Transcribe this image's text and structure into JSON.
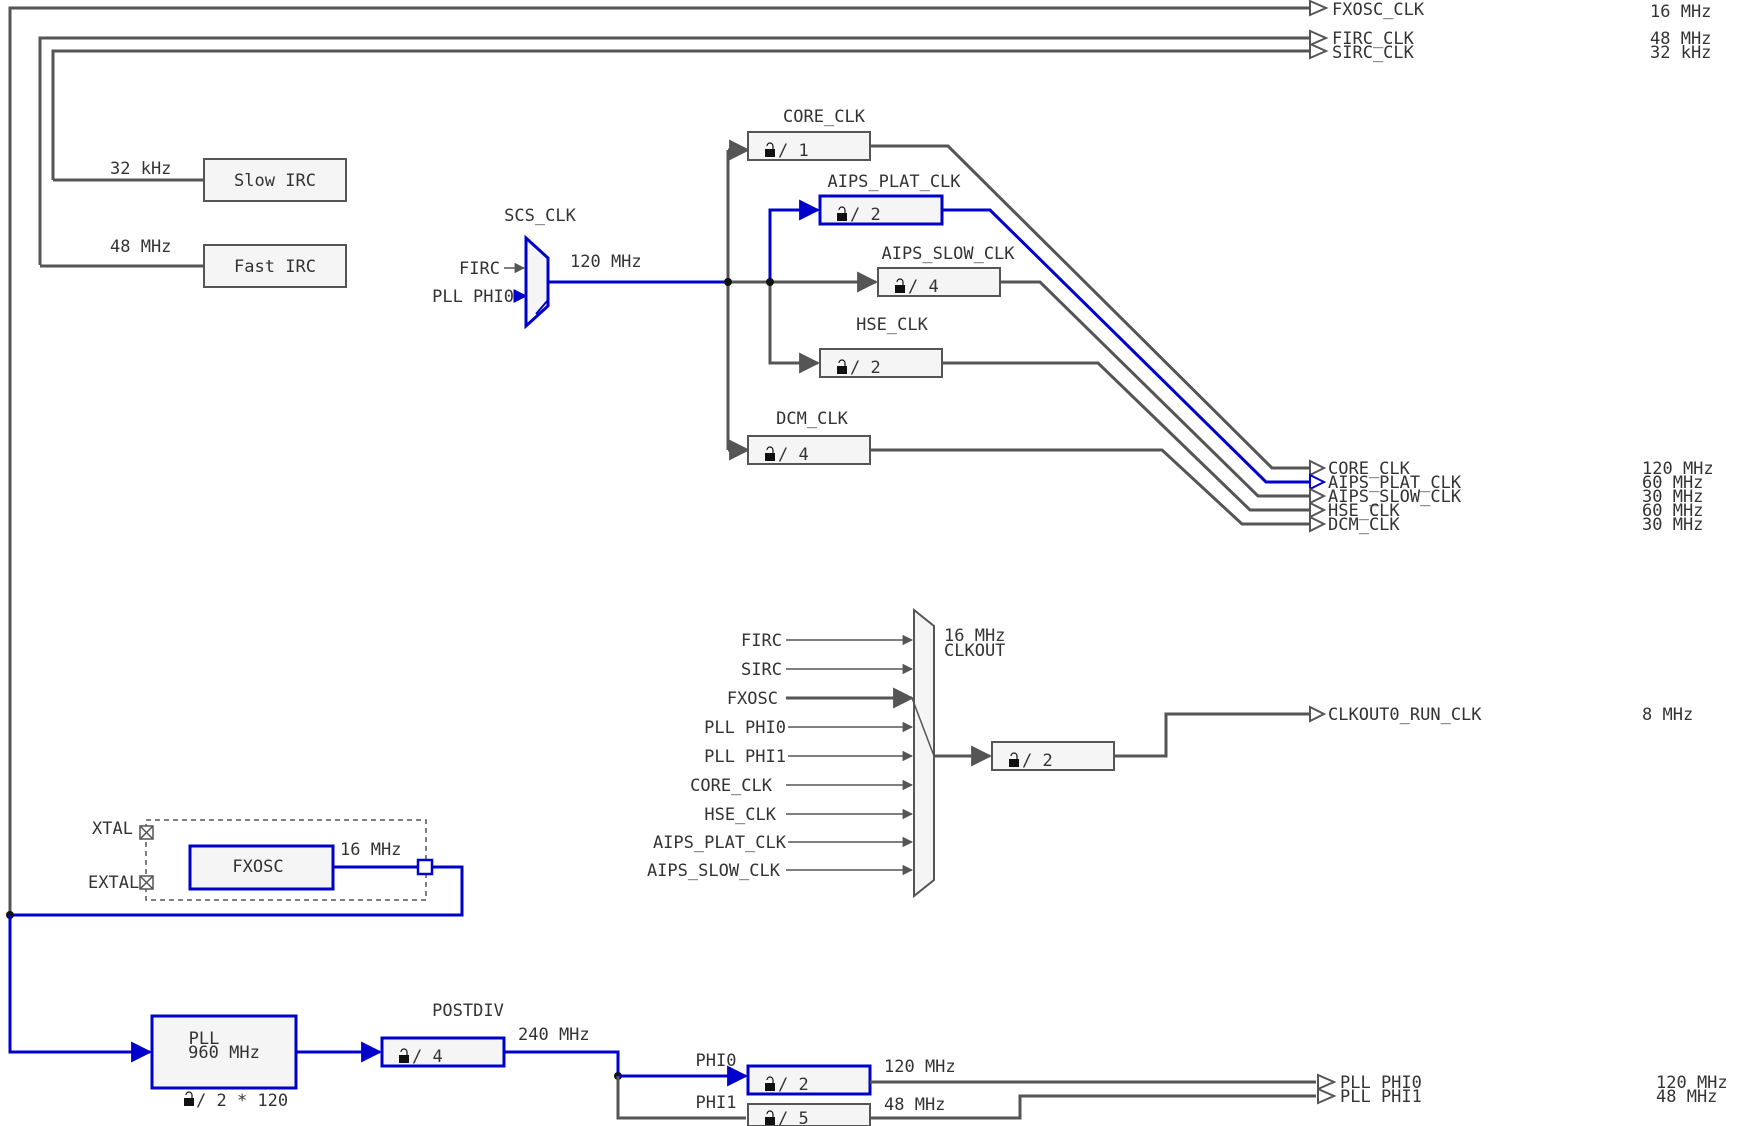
{
  "sources": {
    "slow_irc": {
      "label": "Slow IRC",
      "freq": "32 kHz"
    },
    "fast_irc": {
      "label": "Fast IRC",
      "freq": "48 MHz"
    },
    "fxosc": {
      "label": "FXOSC",
      "freq": "16 MHz",
      "xtal": "XTAL",
      "extal": "EXTAL"
    },
    "pll": {
      "label": "PLL",
      "freq": "960 MHz",
      "mult": "/ 2 * 120"
    }
  },
  "top_outputs": [
    {
      "name": "FXOSC_CLK",
      "freq": "16 MHz"
    },
    {
      "name": "FIRC_CLK",
      "freq": "48 MHz"
    },
    {
      "name": "SIRC_CLK",
      "freq": "32 kHz"
    }
  ],
  "scs": {
    "label": "SCS_CLK",
    "inputs": [
      "FIRC",
      "PLL PHI0"
    ],
    "freq": "120 MHz"
  },
  "dividers": [
    {
      "name": "CORE_CLK",
      "div": "/ 1",
      "highlight": false
    },
    {
      "name": "AIPS_PLAT_CLK",
      "div": "/ 2",
      "highlight": true
    },
    {
      "name": "AIPS_SLOW_CLK",
      "div": "/ 4",
      "highlight": false
    },
    {
      "name": "HSE_CLK",
      "div": "/ 2",
      "highlight": false
    },
    {
      "name": "DCM_CLK",
      "div": "/ 4",
      "highlight": false
    }
  ],
  "bus_outputs": [
    {
      "name": "CORE_CLK",
      "freq": "120 MHz"
    },
    {
      "name": "AIPS_PLAT_CLK",
      "freq": "60 MHz"
    },
    {
      "name": "AIPS_SLOW_CLK",
      "freq": "30 MHz"
    },
    {
      "name": "HSE_CLK",
      "freq": "60 MHz"
    },
    {
      "name": "DCM_CLK",
      "freq": "30 MHz"
    }
  ],
  "clkout": {
    "label": "CLKOUT",
    "freq": "16 MHz",
    "inputs": [
      "FIRC",
      "SIRC",
      "FXOSC",
      "PLL PHI0",
      "PLL PHI1",
      "CORE_CLK",
      "HSE_CLK",
      "AIPS_PLAT_CLK",
      "AIPS_SLOW_CLK"
    ],
    "div": "/ 2",
    "output": {
      "name": "CLKOUT0_RUN_CLK",
      "freq": "8 MHz"
    }
  },
  "pll_chain": {
    "postdiv": {
      "label": "POSTDIV",
      "div": "/ 4",
      "freq": "240 MHz"
    },
    "phi0": {
      "label": "PHI0",
      "div": "/ 2",
      "freq": "120 MHz"
    },
    "phi1": {
      "label": "PHI1",
      "div": "/ 5",
      "freq": "48 MHz"
    }
  },
  "pll_outputs": [
    {
      "name": "PLL PHI0",
      "freq": "120 MHz"
    },
    {
      "name": "PLL PHI1",
      "freq": "48 MHz"
    }
  ],
  "colors": {
    "active": "#0000cc",
    "inactive": "#555555"
  }
}
